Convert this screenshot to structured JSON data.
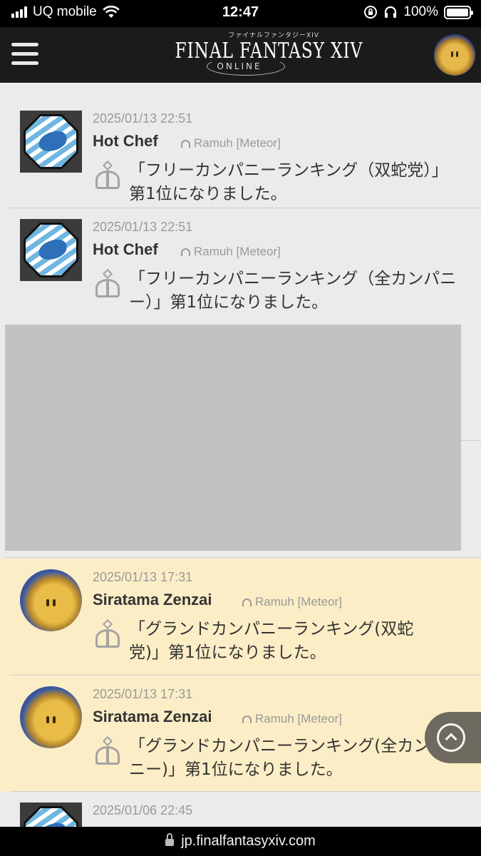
{
  "status_bar": {
    "carrier": "UQ mobile",
    "time": "12:47",
    "battery": "100%",
    "icons": [
      "signal-icon",
      "wifi-icon",
      "rotation-lock-icon",
      "headphones-icon",
      "battery-icon"
    ]
  },
  "header": {
    "logo_title": "FINAL FANTASY XIV",
    "logo_kana": "ファイナルファンタジーXIV",
    "logo_subtitle": "ONLINE"
  },
  "feed": {
    "entries": [
      {
        "date": "2025/01/13 22:51",
        "name": "Hot Chef",
        "world": "Ramuh [Meteor]",
        "message": "「フリーカンパニーランキング（双蛇党）」第1位になりました。",
        "avatar": "free-company-crest",
        "highlight": false
      },
      {
        "date": "2025/01/13 22:51",
        "name": "Hot Chef",
        "world": "Ramuh [Meteor]",
        "message": "「フリーカンパニーランキング（全カンパニー）」第1位になりました。",
        "avatar": "free-company-crest",
        "highlight": false
      },
      {
        "date": "2025/01/13 17:31",
        "name": "Siratama Zenzai",
        "world": "Ramuh [Meteor]",
        "message": "「グランドカンパニーランキング(双蛇党)」第1位になりました。",
        "avatar": "character-portrait",
        "highlight": true
      },
      {
        "date": "2025/01/13 17:31",
        "name": "Siratama Zenzai",
        "world": "Ramuh [Meteor]",
        "message": "「グランドカンパニーランキング(全カンパニー)」第1位になりました。",
        "avatar": "character-portrait",
        "highlight": true
      },
      {
        "date": "2025/01/06 22:45",
        "avatar": "free-company-crest",
        "highlight": false
      }
    ]
  },
  "url_bar": {
    "url": "jp.finalfantasyxiv.com"
  },
  "colors": {
    "page_bg": "#ebebeb",
    "highlight_bg": "#fbedc6",
    "header_bg": "#1b1b1b",
    "ad_placeholder": "#c2c2c2"
  }
}
